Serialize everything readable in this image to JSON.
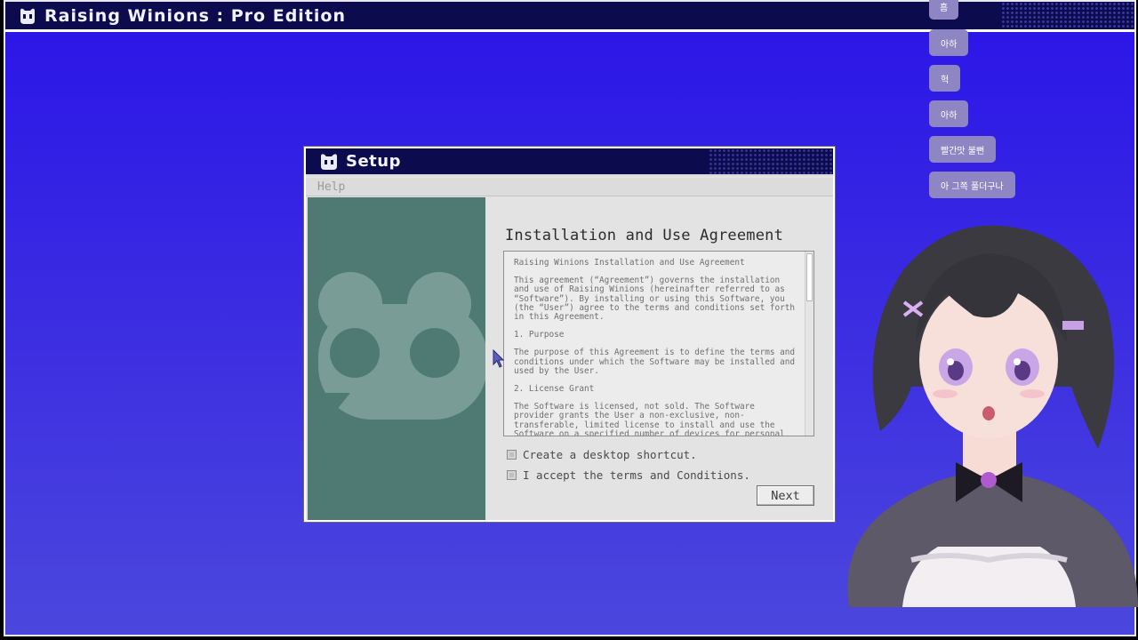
{
  "app": {
    "title": "Raising Winions : Pro Edition"
  },
  "setup": {
    "title": "Setup",
    "menu": {
      "help": "Help"
    },
    "heading": "Installation and Use Agreement",
    "agreement": [
      "Raising Winions Installation and Use Agreement",
      "This agreement (“Agreement”) governs the installation and use of Raising Winions (hereinafter referred to as “Software”). By installing or using this Software, you (the “User”) agree to the terms and conditions set forth in this Agreement.",
      "1. Purpose",
      "The purpose of this Agreement is to define the terms and conditions under which the Software may be installed and used by the User.",
      "2. License Grant",
      "The Software is licensed, not sold. The Software provider grants the User a non-exclusive, non-transferable, limited license to install and use the Software on a specified number of devices for personal or internal use only. In"
    ],
    "options": {
      "desktop_shortcut": "Create a desktop shortcut.",
      "accept_terms": "I accept the terms and Conditions."
    },
    "next_label": "Next"
  },
  "chat": {
    "messages": [
      "흠",
      "아하",
      "헉",
      "아하",
      "빨간맛 불뻔",
      "아 그쪽 풀더구나"
    ]
  },
  "colors": {
    "desktop": "#2a14e8",
    "titlebar": "#0b0b4e",
    "side_panel": "#4f7a73",
    "chat_bubble": "#8e86c2"
  }
}
